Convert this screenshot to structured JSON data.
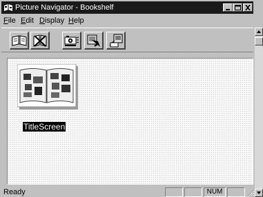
{
  "window": {
    "title": "Picture Navigator - Bookshelf",
    "controls": [
      "minimize-icon",
      "maximize-icon",
      "close-icon"
    ]
  },
  "menu": {
    "items": [
      {
        "label": "File",
        "accel": "F",
        "rest": "ile"
      },
      {
        "label": "Edit",
        "accel": "E",
        "rest": "dit"
      },
      {
        "label": "Display",
        "accel": "D",
        "rest": "isplay"
      },
      {
        "label": "Help",
        "accel": "H",
        "rest": "elp"
      }
    ]
  },
  "toolbar": {
    "buttons": [
      "open-book-icon",
      "close-book-icon",
      "camera-icon",
      "import-icon",
      "export-icon"
    ]
  },
  "content": {
    "albums": [
      {
        "caption": "TitleScreen",
        "selected": true
      }
    ]
  },
  "statusbar": {
    "text": "Ready",
    "num_indicator": "NUM"
  },
  "colors": {
    "titlebar": "#1a1a1a",
    "selection": "#000000",
    "face": "#c0c0c0"
  }
}
